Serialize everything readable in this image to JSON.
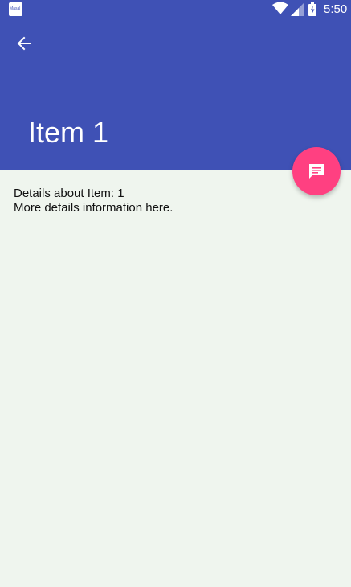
{
  "status_bar": {
    "notification_icon": "app-notification-icon",
    "notification_label": "Masal",
    "icons": [
      "wifi-icon",
      "signal-icon",
      "battery-icon"
    ],
    "time": "5:50"
  },
  "toolbar": {
    "back_icon": "arrow-back-icon",
    "title": "Item 1",
    "background_color": "#3F51B5"
  },
  "fab": {
    "icon": "message-icon",
    "color": "#FF4081"
  },
  "details": {
    "line1": "Details about Item: 1",
    "line2": "More details information here."
  },
  "background_color": "#EFF5EE"
}
